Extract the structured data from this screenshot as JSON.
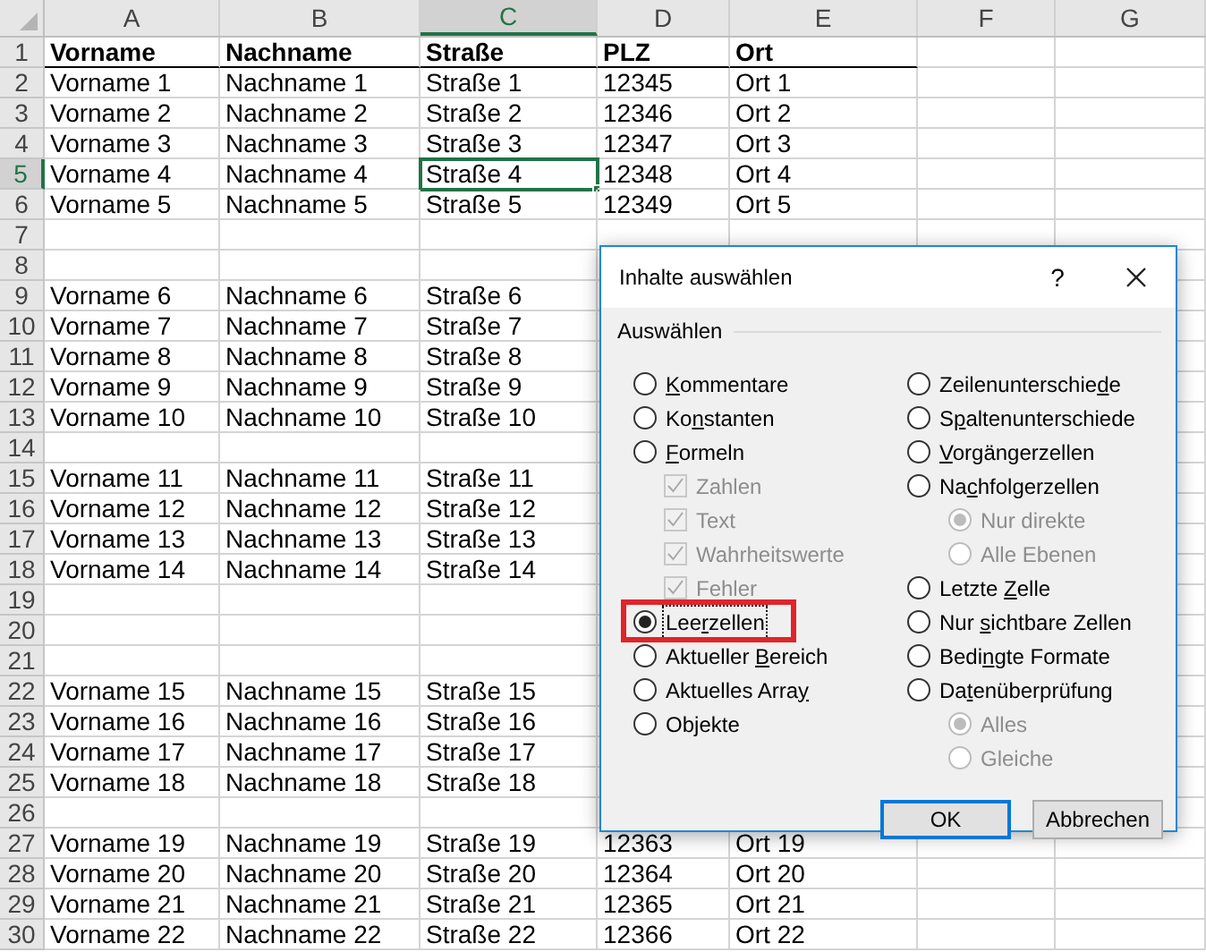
{
  "table": {
    "columns": [
      {
        "label": "A",
        "selected": false
      },
      {
        "label": "B",
        "selected": false
      },
      {
        "label": "C",
        "selected": true
      },
      {
        "label": "D",
        "selected": false
      },
      {
        "label": "E",
        "selected": false
      },
      {
        "label": "F",
        "selected": false
      },
      {
        "label": "G",
        "selected": false
      }
    ],
    "rows": [
      {
        "number": "1",
        "selected": false,
        "kind": "header",
        "cells": [
          {
            "text": "Vorname",
            "selected": false
          },
          {
            "text": "Nachname",
            "selected": false
          },
          {
            "text": "Straße",
            "selected": false
          },
          {
            "text": "PLZ",
            "selected": false
          },
          {
            "text": "Ort",
            "selected": false
          }
        ]
      },
      {
        "number": "2",
        "selected": false,
        "kind": "data",
        "cells": [
          {
            "text": "Vorname 1",
            "selected": false
          },
          {
            "text": "Nachname 1",
            "selected": false
          },
          {
            "text": "Straße 1",
            "selected": false
          },
          {
            "text": "12345",
            "selected": false
          },
          {
            "text": "Ort 1",
            "selected": false
          }
        ]
      },
      {
        "number": "3",
        "selected": false,
        "kind": "data",
        "cells": [
          {
            "text": "Vorname 2",
            "selected": false
          },
          {
            "text": "Nachname 2",
            "selected": false
          },
          {
            "text": "Straße 2",
            "selected": false
          },
          {
            "text": "12346",
            "selected": false
          },
          {
            "text": "Ort 2",
            "selected": false
          }
        ]
      },
      {
        "number": "4",
        "selected": false,
        "kind": "data",
        "cells": [
          {
            "text": "Vorname 3",
            "selected": false
          },
          {
            "text": "Nachname 3",
            "selected": false
          },
          {
            "text": "Straße 3",
            "selected": false
          },
          {
            "text": "12347",
            "selected": false
          },
          {
            "text": "Ort 3",
            "selected": false
          }
        ]
      },
      {
        "number": "5",
        "selected": true,
        "kind": "data",
        "cells": [
          {
            "text": "Vorname 4",
            "selected": false
          },
          {
            "text": "Nachname 4",
            "selected": false
          },
          {
            "text": "Straße 4",
            "selected": true
          },
          {
            "text": "12348",
            "selected": false
          },
          {
            "text": "Ort 4",
            "selected": false
          }
        ]
      },
      {
        "number": "6",
        "selected": false,
        "kind": "data",
        "cells": [
          {
            "text": "Vorname 5",
            "selected": false
          },
          {
            "text": "Nachname 5",
            "selected": false
          },
          {
            "text": "Straße 5",
            "selected": false
          },
          {
            "text": "12349",
            "selected": false
          },
          {
            "text": "Ort 5",
            "selected": false
          }
        ]
      },
      {
        "number": "7",
        "selected": false,
        "kind": "data"
      },
      {
        "number": "8",
        "selected": false,
        "kind": "data"
      },
      {
        "number": "9",
        "selected": false,
        "kind": "data",
        "cells": [
          {
            "text": "Vorname 6",
            "selected": false
          },
          {
            "text": "Nachname 6",
            "selected": false
          },
          {
            "text": "Straße 6",
            "selected": false
          }
        ]
      },
      {
        "number": "10",
        "selected": false,
        "kind": "data",
        "cells": [
          {
            "text": "Vorname 7",
            "selected": false
          },
          {
            "text": "Nachname 7",
            "selected": false
          },
          {
            "text": "Straße 7",
            "selected": false
          }
        ]
      },
      {
        "number": "11",
        "selected": false,
        "kind": "data",
        "cells": [
          {
            "text": "Vorname 8",
            "selected": false
          },
          {
            "text": "Nachname 8",
            "selected": false
          },
          {
            "text": "Straße 8",
            "selected": false
          }
        ]
      },
      {
        "number": "12",
        "selected": false,
        "kind": "data",
        "cells": [
          {
            "text": "Vorname 9",
            "selected": false
          },
          {
            "text": "Nachname 9",
            "selected": false
          },
          {
            "text": "Straße 9",
            "selected": false
          }
        ]
      },
      {
        "number": "13",
        "selected": false,
        "kind": "data",
        "cells": [
          {
            "text": "Vorname 10",
            "selected": false
          },
          {
            "text": "Nachname 10",
            "selected": false
          },
          {
            "text": "Straße 10",
            "selected": false
          }
        ]
      },
      {
        "number": "14",
        "selected": false,
        "kind": "data"
      },
      {
        "number": "15",
        "selected": false,
        "kind": "data",
        "cells": [
          {
            "text": "Vorname 11",
            "selected": false
          },
          {
            "text": "Nachname 11",
            "selected": false
          },
          {
            "text": "Straße 11",
            "selected": false
          }
        ]
      },
      {
        "number": "16",
        "selected": false,
        "kind": "data",
        "cells": [
          {
            "text": "Vorname 12",
            "selected": false
          },
          {
            "text": "Nachname 12",
            "selected": false
          },
          {
            "text": "Straße 12",
            "selected": false
          }
        ]
      },
      {
        "number": "17",
        "selected": false,
        "kind": "data",
        "cells": [
          {
            "text": "Vorname 13",
            "selected": false
          },
          {
            "text": "Nachname 13",
            "selected": false
          },
          {
            "text": "Straße 13",
            "selected": false
          }
        ]
      },
      {
        "number": "18",
        "selected": false,
        "kind": "data",
        "cells": [
          {
            "text": "Vorname 14",
            "selected": false
          },
          {
            "text": "Nachname 14",
            "selected": false
          },
          {
            "text": "Straße 14",
            "selected": false
          }
        ]
      },
      {
        "number": "19",
        "selected": false,
        "kind": "data"
      },
      {
        "number": "20",
        "selected": false,
        "kind": "data"
      },
      {
        "number": "21",
        "selected": false,
        "kind": "data"
      },
      {
        "number": "22",
        "selected": false,
        "kind": "data",
        "cells": [
          {
            "text": "Vorname 15",
            "selected": false
          },
          {
            "text": "Nachname 15",
            "selected": false
          },
          {
            "text": "Straße 15",
            "selected": false
          }
        ]
      },
      {
        "number": "23",
        "selected": false,
        "kind": "data",
        "cells": [
          {
            "text": "Vorname 16",
            "selected": false
          },
          {
            "text": "Nachname 16",
            "selected": false
          },
          {
            "text": "Straße 16",
            "selected": false
          }
        ]
      },
      {
        "number": "24",
        "selected": false,
        "kind": "data",
        "cells": [
          {
            "text": "Vorname 17",
            "selected": false
          },
          {
            "text": "Nachname 17",
            "selected": false
          },
          {
            "text": "Straße 17",
            "selected": false
          }
        ]
      },
      {
        "number": "25",
        "selected": false,
        "kind": "data",
        "cells": [
          {
            "text": "Vorname 18",
            "selected": false
          },
          {
            "text": "Nachname 18",
            "selected": false
          },
          {
            "text": "Straße 18",
            "selected": false
          }
        ]
      },
      {
        "number": "26",
        "selected": false,
        "kind": "data"
      },
      {
        "number": "27",
        "selected": false,
        "kind": "data",
        "cells": [
          {
            "text": "Vorname 19",
            "selected": false
          },
          {
            "text": "Nachname 19",
            "selected": false
          },
          {
            "text": "Straße 19",
            "selected": false
          },
          {
            "text": "12363",
            "selected": false
          },
          {
            "text": "Ort 19",
            "selected": false
          }
        ]
      },
      {
        "number": "28",
        "selected": false,
        "kind": "data",
        "cells": [
          {
            "text": "Vorname 20",
            "selected": false
          },
          {
            "text": "Nachname 20",
            "selected": false
          },
          {
            "text": "Straße 20",
            "selected": false
          },
          {
            "text": "12364",
            "selected": false
          },
          {
            "text": "Ort 20",
            "selected": false
          }
        ]
      },
      {
        "number": "29",
        "selected": false,
        "kind": "data",
        "cells": [
          {
            "text": "Vorname 21",
            "selected": false
          },
          {
            "text": "Nachname 21",
            "selected": false
          },
          {
            "text": "Straße 21",
            "selected": false
          },
          {
            "text": "12365",
            "selected": false
          },
          {
            "text": "Ort 21",
            "selected": false
          }
        ]
      },
      {
        "number": "30",
        "selected": false,
        "kind": "data",
        "cells": [
          {
            "text": "Vorname 22",
            "selected": false
          },
          {
            "text": "Nachname 22",
            "selected": false
          },
          {
            "text": "Straße 22",
            "selected": false
          },
          {
            "text": "12366",
            "selected": false
          },
          {
            "text": "Ort 22",
            "selected": false
          }
        ]
      }
    ]
  },
  "dialog": {
    "title": "Inhalte auswählen",
    "help": "?",
    "group_label": "Auswählen",
    "left_options": [
      {
        "kind": "radio",
        "label_parts": [
          {
            "text": "K",
            "underlined": true
          },
          {
            "text": "ommentare",
            "underlined": false
          }
        ],
        "selected": false,
        "disabled": false,
        "focused": false,
        "highlighted": false
      },
      {
        "kind": "radio",
        "label_parts": [
          {
            "text": "Ko",
            "underlined": false
          },
          {
            "text": "n",
            "underlined": true
          },
          {
            "text": "stanten",
            "underlined": false
          }
        ],
        "selected": false,
        "disabled": false,
        "focused": false,
        "highlighted": false
      },
      {
        "kind": "radio",
        "label_parts": [
          {
            "text": "F",
            "underlined": true
          },
          {
            "text": "ormeln",
            "underlined": false
          }
        ],
        "selected": false,
        "disabled": false,
        "focused": false,
        "highlighted": false,
        "children": [
          {
            "kind": "checkbox",
            "label_parts": [
              {
                "text": "Zahlen",
                "underlined": false
              }
            ],
            "checked": true,
            "disabled": true
          },
          {
            "kind": "checkbox",
            "label_parts": [
              {
                "text": "Text",
                "underlined": false
              }
            ],
            "checked": true,
            "disabled": true
          },
          {
            "kind": "checkbox",
            "label_parts": [
              {
                "text": "Wahrheitswerte",
                "underlined": false
              }
            ],
            "checked": true,
            "disabled": true
          },
          {
            "kind": "checkbox",
            "label_parts": [
              {
                "text": "Fehler",
                "underlined": false
              }
            ],
            "checked": true,
            "disabled": true
          }
        ]
      },
      {
        "kind": "radio",
        "label_parts": [
          {
            "text": "Lee",
            "underlined": false
          },
          {
            "text": "r",
            "underlined": true
          },
          {
            "text": "zellen",
            "underlined": false
          }
        ],
        "selected": true,
        "disabled": false,
        "focused": true,
        "highlighted": true
      },
      {
        "kind": "radio",
        "label_parts": [
          {
            "text": "Aktueller ",
            "underlined": false
          },
          {
            "text": "B",
            "underlined": true
          },
          {
            "text": "ereich",
            "underlined": false
          }
        ],
        "selected": false,
        "disabled": false,
        "focused": false,
        "highlighted": false
      },
      {
        "kind": "radio",
        "label_parts": [
          {
            "text": "Aktuelles Arra",
            "underlined": false
          },
          {
            "text": "y",
            "underlined": true
          }
        ],
        "selected": false,
        "disabled": false,
        "focused": false,
        "highlighted": false
      },
      {
        "kind": "radio",
        "label_parts": [
          {
            "text": "Ob",
            "underlined": false
          },
          {
            "text": "j",
            "underlined": true
          },
          {
            "text": "ekte",
            "underlined": false
          }
        ],
        "selected": false,
        "disabled": false,
        "focused": false,
        "highlighted": false
      }
    ],
    "right_options": [
      {
        "kind": "radio",
        "label_parts": [
          {
            "text": "Zeilenunterschie",
            "underlined": false
          },
          {
            "text": "d",
            "underlined": true
          },
          {
            "text": "e",
            "underlined": false
          }
        ],
        "selected": false,
        "disabled": false,
        "focused": false,
        "highlighted": false
      },
      {
        "kind": "radio",
        "label_parts": [
          {
            "text": "S",
            "underlined": false
          },
          {
            "text": "p",
            "underlined": true
          },
          {
            "text": "altenunterschiede",
            "underlined": false
          }
        ],
        "selected": false,
        "disabled": false,
        "focused": false,
        "highlighted": false
      },
      {
        "kind": "radio",
        "label_parts": [
          {
            "text": "V",
            "underlined": true
          },
          {
            "text": "orgängerzellen",
            "underlined": false
          }
        ],
        "selected": false,
        "disabled": false,
        "focused": false,
        "highlighted": false
      },
      {
        "kind": "radio",
        "label_parts": [
          {
            "text": "Na",
            "underlined": false
          },
          {
            "text": "c",
            "underlined": true
          },
          {
            "text": "hfolgerzellen",
            "underlined": false
          }
        ],
        "selected": false,
        "disabled": false,
        "focused": false,
        "highlighted": false,
        "children": [
          {
            "kind": "radio",
            "label_parts": [
              {
                "text": "Nur direkte",
                "underlined": false
              }
            ],
            "selected": true,
            "disabled": true,
            "focused": false,
            "highlighted": false
          },
          {
            "kind": "radio",
            "label_parts": [
              {
                "text": "Alle Ebenen",
                "underlined": false
              }
            ],
            "selected": false,
            "disabled": true,
            "focused": false,
            "highlighted": false
          }
        ]
      },
      {
        "kind": "radio",
        "label_parts": [
          {
            "text": "Letzte ",
            "underlined": false
          },
          {
            "text": "Z",
            "underlined": true
          },
          {
            "text": "elle",
            "underlined": false
          }
        ],
        "selected": false,
        "disabled": false,
        "focused": false,
        "highlighted": false
      },
      {
        "kind": "radio",
        "label_parts": [
          {
            "text": "Nur ",
            "underlined": false
          },
          {
            "text": "s",
            "underlined": true
          },
          {
            "text": "ichtbare Zellen",
            "underlined": false
          }
        ],
        "selected": false,
        "disabled": false,
        "focused": false,
        "highlighted": false
      },
      {
        "kind": "radio",
        "label_parts": [
          {
            "text": "Bedi",
            "underlined": false
          },
          {
            "text": "n",
            "underlined": true
          },
          {
            "text": "gte Formate",
            "underlined": false
          }
        ],
        "selected": false,
        "disabled": false,
        "focused": false,
        "highlighted": false
      },
      {
        "kind": "radio",
        "label_parts": [
          {
            "text": "Da",
            "underlined": false
          },
          {
            "text": "t",
            "underlined": true
          },
          {
            "text": "enüberprüfung",
            "underlined": false
          }
        ],
        "selected": false,
        "disabled": false,
        "focused": false,
        "highlighted": false,
        "children": [
          {
            "kind": "radio",
            "label_parts": [
              {
                "text": "Alles",
                "underlined": false
              }
            ],
            "selected": true,
            "disabled": true,
            "focused": false,
            "highlighted": false
          },
          {
            "kind": "radio",
            "label_parts": [
              {
                "text": "Gleiche",
                "underlined": false
              }
            ],
            "selected": false,
            "disabled": true,
            "focused": false,
            "highlighted": false
          }
        ]
      }
    ],
    "buttons": [
      {
        "label": "OK",
        "default": true
      },
      {
        "label": "Abbrechen",
        "default": false
      }
    ]
  }
}
